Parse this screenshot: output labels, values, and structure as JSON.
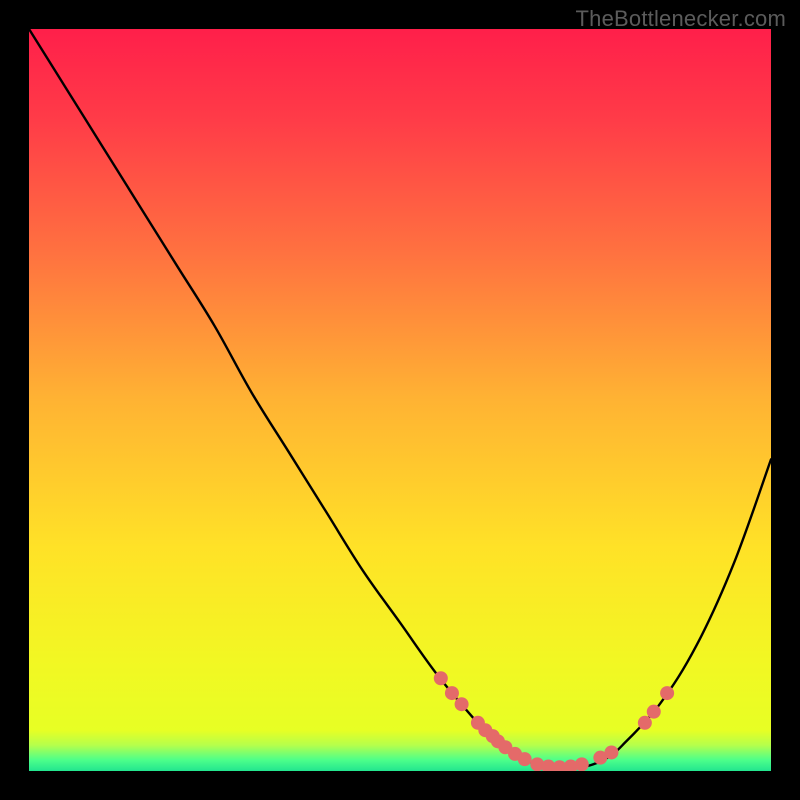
{
  "attribution": "TheBottlenecker.com",
  "chart_data": {
    "type": "line",
    "title": "",
    "xlabel": "",
    "ylabel": "",
    "xlim": [
      0,
      100
    ],
    "ylim": [
      0,
      100
    ],
    "grid": false,
    "background": "red-yellow-green vertical gradient",
    "series": [
      {
        "name": "curve",
        "x": [
          0,
          5,
          10,
          15,
          20,
          25,
          30,
          35,
          40,
          45,
          50,
          55,
          60,
          62,
          65,
          67,
          70,
          72,
          75,
          78,
          80,
          85,
          90,
          95,
          100
        ],
        "y": [
          100,
          92,
          84,
          76,
          68,
          60,
          51,
          43,
          35,
          27,
          20,
          13,
          7,
          5,
          2.5,
          1.4,
          0.6,
          0.4,
          0.6,
          1.8,
          3.5,
          9,
          17,
          28,
          42
        ],
        "color": "#000000"
      }
    ],
    "markers": [
      {
        "x": 55.5,
        "y": 12.5
      },
      {
        "x": 57.0,
        "y": 10.5
      },
      {
        "x": 58.3,
        "y": 9.0
      },
      {
        "x": 60.5,
        "y": 6.5
      },
      {
        "x": 61.5,
        "y": 5.5
      },
      {
        "x": 62.5,
        "y": 4.7
      },
      {
        "x": 63.2,
        "y": 4.0
      },
      {
        "x": 64.2,
        "y": 3.2
      },
      {
        "x": 65.5,
        "y": 2.3
      },
      {
        "x": 66.8,
        "y": 1.6
      },
      {
        "x": 68.5,
        "y": 0.9
      },
      {
        "x": 70.0,
        "y": 0.6
      },
      {
        "x": 71.5,
        "y": 0.5
      },
      {
        "x": 73.0,
        "y": 0.6
      },
      {
        "x": 74.5,
        "y": 0.9
      },
      {
        "x": 77.0,
        "y": 1.8
      },
      {
        "x": 78.5,
        "y": 2.5
      },
      {
        "x": 83.0,
        "y": 6.5
      },
      {
        "x": 84.2,
        "y": 8.0
      },
      {
        "x": 86.0,
        "y": 10.5
      }
    ],
    "marker_style": {
      "color": "#e46a69",
      "radius_px": 7
    },
    "gradient_stops": [
      {
        "offset": 0.0,
        "color": "#ff1f4a"
      },
      {
        "offset": 0.12,
        "color": "#ff3b48"
      },
      {
        "offset": 0.3,
        "color": "#ff7140"
      },
      {
        "offset": 0.5,
        "color": "#ffb333"
      },
      {
        "offset": 0.7,
        "color": "#ffe227"
      },
      {
        "offset": 0.85,
        "color": "#f2f723"
      },
      {
        "offset": 0.945,
        "color": "#e7ff24"
      },
      {
        "offset": 0.965,
        "color": "#b6ff4b"
      },
      {
        "offset": 0.985,
        "color": "#4dff8a"
      },
      {
        "offset": 1.0,
        "color": "#22e58f"
      }
    ]
  }
}
